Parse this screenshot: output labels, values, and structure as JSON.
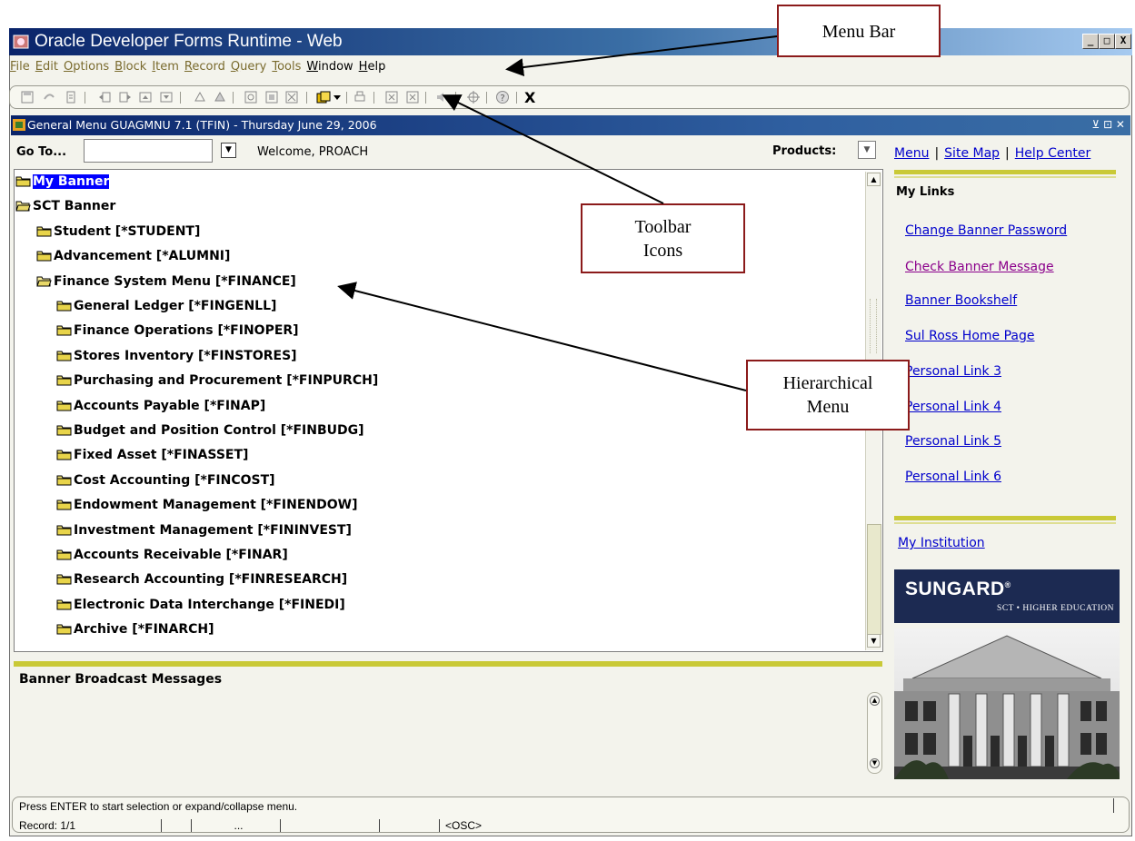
{
  "window": {
    "title": "Oracle Developer Forms Runtime - Web",
    "minimize": "_",
    "maximize": "□",
    "close": "X"
  },
  "menubar": {
    "items": [
      {
        "label": "File",
        "key": "F",
        "rest": "ile"
      },
      {
        "label": "Edit",
        "key": "E",
        "rest": "dit"
      },
      {
        "label": "Options",
        "key": "O",
        "rest": "ptions"
      },
      {
        "label": "Block",
        "key": "B",
        "rest": "lock"
      },
      {
        "label": "Item",
        "key": "I",
        "rest": "tem"
      },
      {
        "label": "Record",
        "key": "R",
        "rest": "ecord"
      },
      {
        "label": "Query",
        "key": "Q",
        "rest": "uery"
      },
      {
        "label": "Tools",
        "key": "T",
        "rest": "ools"
      },
      {
        "label": "Window",
        "key": "W",
        "rest": "indow"
      },
      {
        "label": "Help",
        "key": "H",
        "rest": "elp"
      }
    ]
  },
  "toolbar": {
    "icons": [
      "save-icon",
      "rollback-icon",
      "print-icon",
      "previous-block-icon",
      "next-block-icon",
      "previous-record-icon",
      "next-record-icon",
      "insert-record-icon",
      "delete-record-icon",
      "enter-query-icon",
      "execute-query-icon",
      "cancel-query-icon",
      "open-folder-icon",
      "print-icon",
      "extract-icon",
      "export-icon",
      "speaker-icon",
      "crosshair-icon",
      "help-icon"
    ],
    "exit_label": "X"
  },
  "form": {
    "title": "General Menu  GUAGMNU  7.1  (TFIN) - Thursday June 29, 2006",
    "controls": "⊻ ⊡ ✕"
  },
  "goto": {
    "label": "Go To...",
    "value": "",
    "welcome": "Welcome, PROACH"
  },
  "products": {
    "label": "Products:"
  },
  "tree": {
    "items": [
      {
        "label": "My Banner",
        "level": 0,
        "open": false,
        "selected": true
      },
      {
        "label": "SCT Banner",
        "level": 0,
        "open": true,
        "selected": false
      },
      {
        "label": "Student [*STUDENT]",
        "level": 1,
        "open": false,
        "selected": false
      },
      {
        "label": "Advancement [*ALUMNI]",
        "level": 1,
        "open": false,
        "selected": false
      },
      {
        "label": "Finance System Menu [*FINANCE]",
        "level": 1,
        "open": true,
        "selected": false
      },
      {
        "label": "General Ledger [*FINGENLL]",
        "level": 2,
        "open": false,
        "selected": false
      },
      {
        "label": "Finance Operations [*FINOPER]",
        "level": 2,
        "open": false,
        "selected": false
      },
      {
        "label": "Stores Inventory [*FINSTORES]",
        "level": 2,
        "open": false,
        "selected": false
      },
      {
        "label": "Purchasing and Procurement [*FINPURCH]",
        "level": 2,
        "open": false,
        "selected": false
      },
      {
        "label": "Accounts Payable [*FINAP]",
        "level": 2,
        "open": false,
        "selected": false
      },
      {
        "label": "Budget and Position Control [*FINBUDG]",
        "level": 2,
        "open": false,
        "selected": false
      },
      {
        "label": "Fixed Asset [*FINASSET]",
        "level": 2,
        "open": false,
        "selected": false
      },
      {
        "label": "Cost Accounting [*FINCOST]",
        "level": 2,
        "open": false,
        "selected": false
      },
      {
        "label": "Endowment Management [*FINENDOW]",
        "level": 2,
        "open": false,
        "selected": false
      },
      {
        "label": "Investment Management [*FININVEST]",
        "level": 2,
        "open": false,
        "selected": false
      },
      {
        "label": "Accounts Receivable [*FINAR]",
        "level": 2,
        "open": false,
        "selected": false
      },
      {
        "label": "Research Accounting [*FINRESEARCH]",
        "level": 2,
        "open": false,
        "selected": false
      },
      {
        "label": "Electronic Data Interchange [*FINEDI]",
        "level": 2,
        "open": false,
        "selected": false
      },
      {
        "label": "Archive [*FINARCH]",
        "level": 2,
        "open": false,
        "selected": false
      }
    ]
  },
  "broadcast": {
    "title": "Banner Broadcast Messages"
  },
  "sidebar": {
    "top_links": [
      "Menu",
      "Site Map",
      "Help Center"
    ],
    "my_links_title": "My Links",
    "links": [
      {
        "label": "Change Banner Password",
        "visited": false
      },
      {
        "label": "Check Banner Message",
        "visited": true
      },
      {
        "label": "Banner Bookshelf",
        "visited": false
      },
      {
        "label": "Sul Ross Home Page",
        "visited": false
      },
      {
        "label": "Personal Link 3",
        "visited": false
      },
      {
        "label": "Personal Link 4",
        "visited": false
      },
      {
        "label": "Personal Link 5",
        "visited": false
      },
      {
        "label": "Personal Link 6",
        "visited": false
      }
    ],
    "my_institution": "My Institution",
    "logo_main": "SUNGARD",
    "logo_mark": "®",
    "logo_sub": "SCT • HIGHER EDUCATION"
  },
  "status": {
    "message": "Press ENTER to start selection or expand/collapse menu.",
    "record": "Record: 1/1",
    "field3": "...",
    "mode": "<OSC>"
  },
  "callouts": {
    "menu_bar": "Menu Bar",
    "toolbar_icons": [
      "Toolbar",
      "Icons"
    ],
    "hierarchical_menu": [
      "Hierarchical",
      "Menu"
    ]
  },
  "colors": {
    "callout_border": "#8b1a1a",
    "link": "#0000cc",
    "visited_link": "#8b008b",
    "accent_bar": "#c9c937",
    "selection": "#0000ff"
  }
}
